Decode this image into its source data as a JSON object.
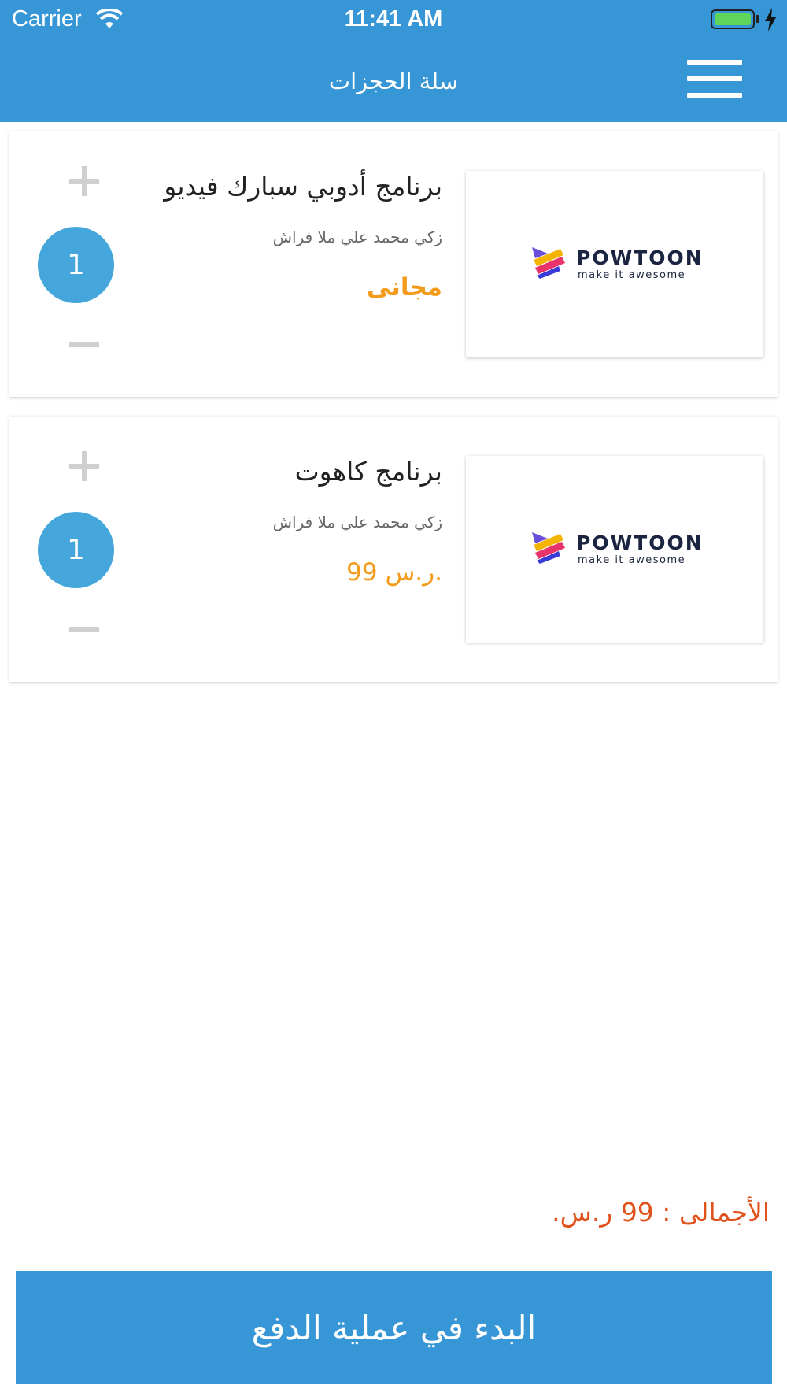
{
  "status_bar": {
    "carrier": "Carrier",
    "time": "11:41 AM",
    "battery_level": 1.0
  },
  "nav": {
    "title": "سلة الحجزات",
    "menu_icon": "hamburger-menu-icon"
  },
  "cart": {
    "items": [
      {
        "title": "برنامج أدوبي سبارك فيديو",
        "instructor": "زكي محمد علي ملا فراش",
        "price": "مجانى",
        "quantity": "1",
        "thumbnail": {
          "brand": "POWTOON",
          "tagline": "make it awesome"
        }
      },
      {
        "title": "برنامج كاهوت",
        "instructor": "زكي محمد علي ملا فراش",
        "price": "99 ر.س.",
        "quantity": "1",
        "thumbnail": {
          "brand": "POWTOON",
          "tagline": "make it awesome"
        }
      }
    ]
  },
  "summary": {
    "total": "الأجمالى : 99 ر.س."
  },
  "checkout": {
    "button_label": "البدء في عملية الدفع"
  },
  "colors": {
    "primary": "#3796d5",
    "price": "#f39c1c",
    "total": "#e0521c",
    "quantity_circle": "#45a6dc"
  }
}
